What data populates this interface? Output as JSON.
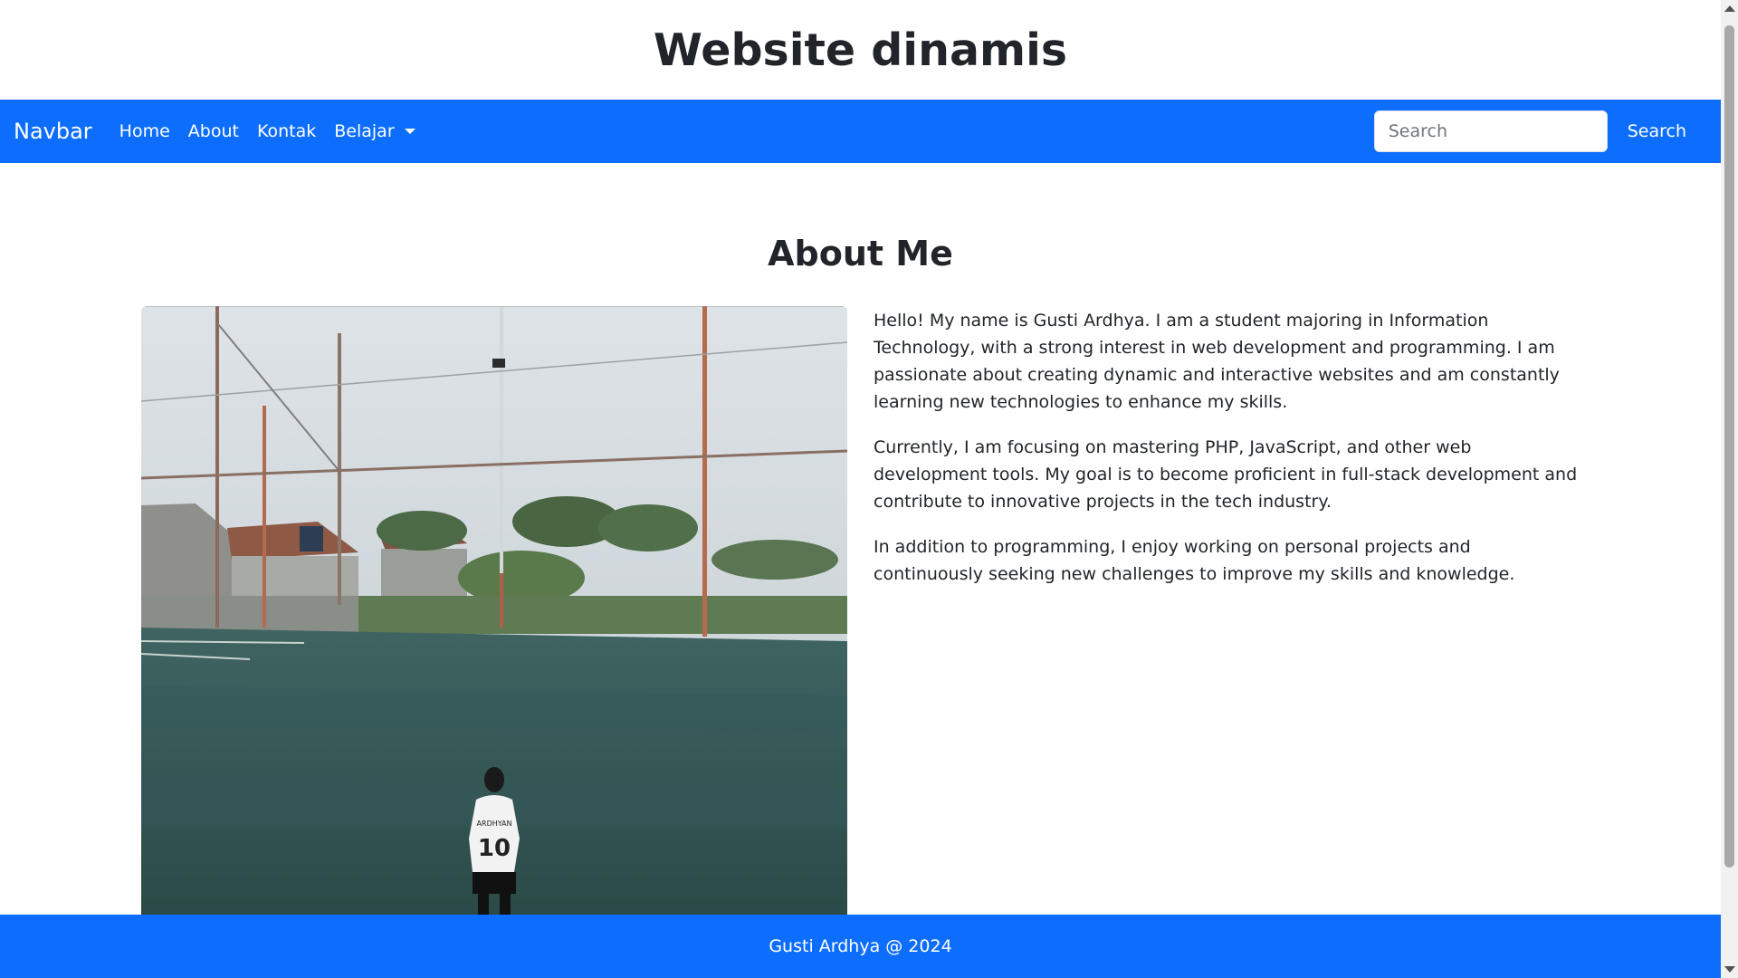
{
  "header": {
    "title": "Website dinamis"
  },
  "navbar": {
    "brand": "Navbar",
    "links": [
      "Home",
      "About",
      "Kontak"
    ],
    "dropdown_label": "Belajar",
    "search_placeholder": "Search",
    "search_button": "Search",
    "color": "#0d6efd"
  },
  "about": {
    "title": "About Me",
    "photo_icon": "photo-person-football-field",
    "paragraphs": [
      "Hello! My name is Gusti Ardhya. I am a student majoring in Information Technology, with a strong interest in web development and programming. I am passionate about creating dynamic and interactive websites and am constantly learning new technologies to enhance my skills.",
      "Currently, I am focusing on mastering PHP, JavaScript, and other web development tools. My goal is to become proficient in full-stack development and contribute to innovative projects in the tech industry.",
      "In addition to programming, I enjoy working on personal projects and continuously seeking new challenges to improve my skills and knowledge."
    ]
  },
  "footer": {
    "text": "Gusti Ardhya @ 2024"
  }
}
